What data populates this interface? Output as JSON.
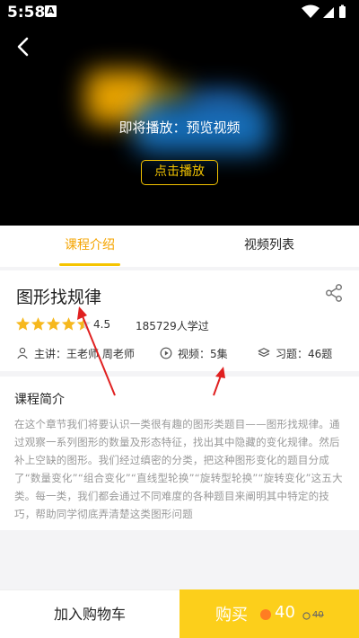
{
  "status_bar": {
    "time": "5:58",
    "notification_icon": "A"
  },
  "player": {
    "title": "即将播放：预览视频",
    "play_label": "点击播放"
  },
  "tabs": [
    {
      "label": "课程介绍",
      "active": true
    },
    {
      "label": "视频列表",
      "active": false
    }
  ],
  "course": {
    "title": "图形找规律",
    "rating": "4.5",
    "rating_value": 4.5,
    "rating_max": 5,
    "learners": "185729人学过",
    "teacher": "主讲：王老师 周老师",
    "videos": "视频：5集",
    "exercises": "习题：46题"
  },
  "intro": {
    "heading": "课程简介",
    "text": "在这个章节我们将要认识一类很有趣的图形类题目——图形找规律。通过观察一系列图形的数量及形态特征，找出其中隐藏的变化规律。然后补上空缺的图形。我们经过缜密的分类，把这种图形变化的题目分成了“数量变化”“组合变化”“直线型轮换”“旋转型轮换”“旋转变化”这五大类。每一类，我们都会通过不同难度的各种题目来阐明其中特定的技巧，帮助同学彻底弄清楚这类图形问题"
  },
  "bottom_bar": {
    "cart_label": "加入购物车",
    "buy_label": "购买",
    "price": "40",
    "original_price": "40"
  },
  "colors": {
    "accent": "#f5a400",
    "buy_bg": "#fccf1b",
    "star": "#f6b81e",
    "annotation": "#e02020"
  }
}
